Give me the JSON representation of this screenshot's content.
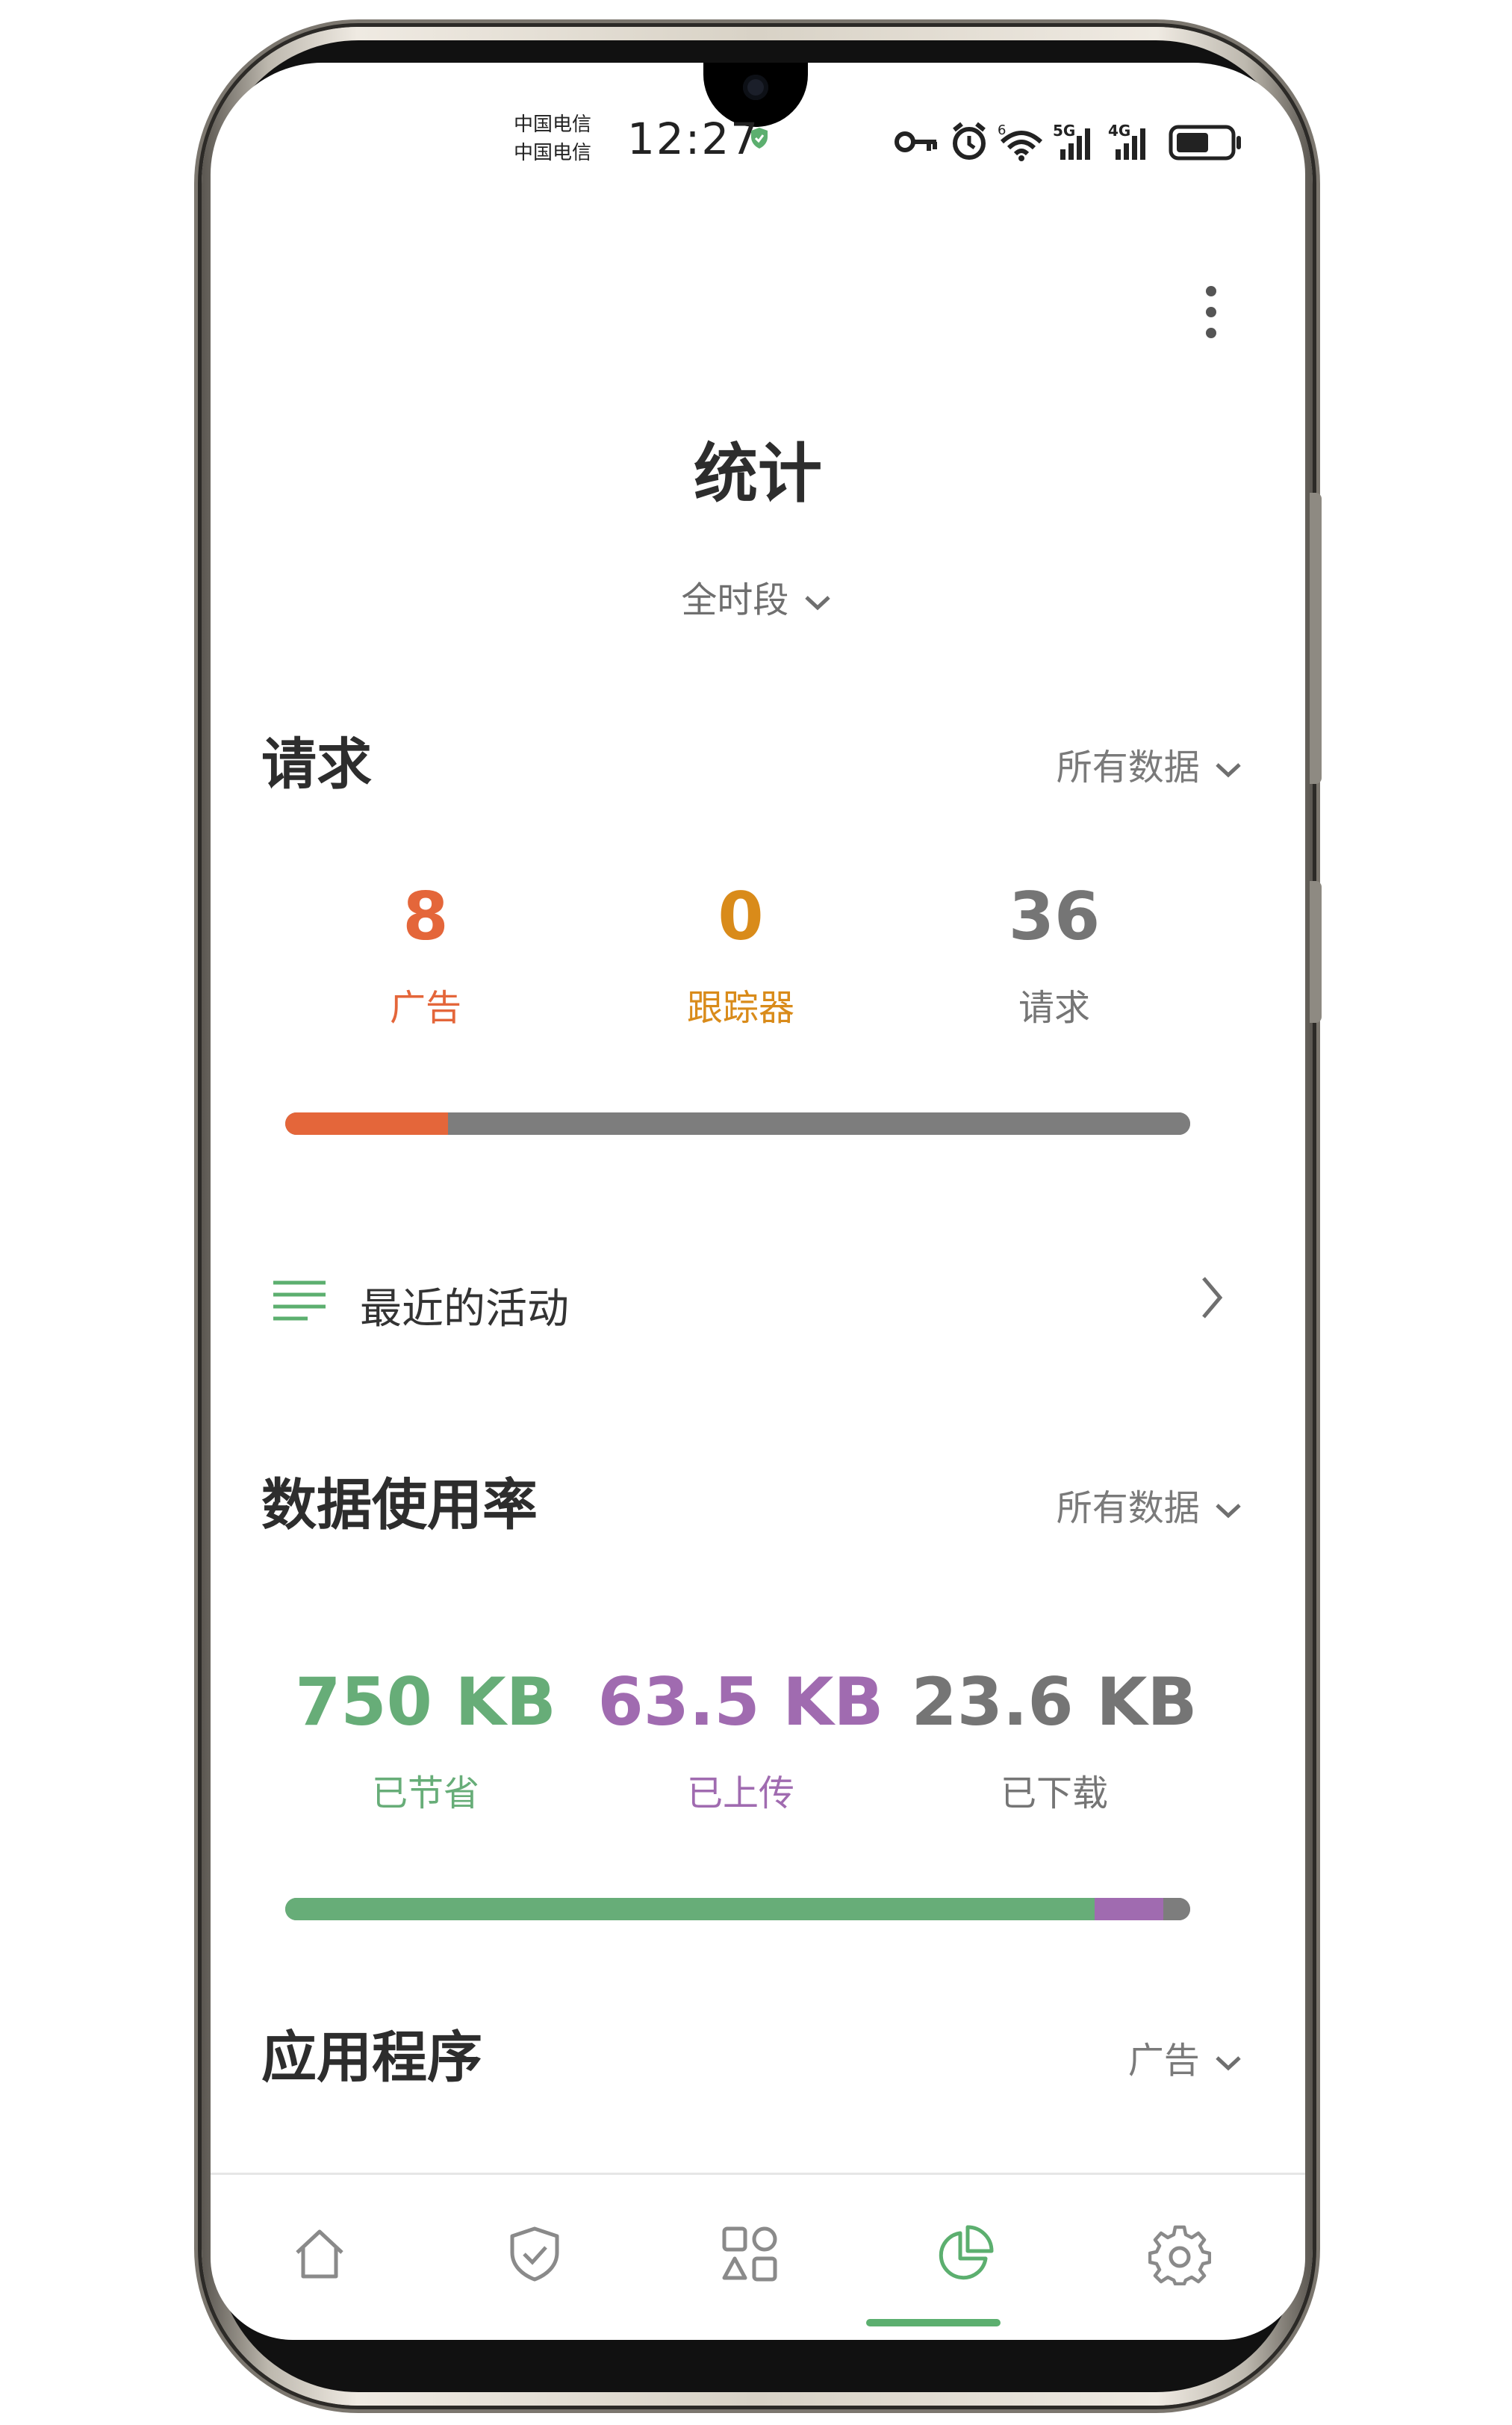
{
  "status_bar": {
    "carrier_1": "中国电信",
    "carrier_2": "中国电信",
    "time": "12:27"
  },
  "header": {
    "title": "统计",
    "period": "全时段"
  },
  "requests": {
    "title": "请求",
    "filter": "所有数据",
    "stats": [
      {
        "value": "8",
        "label": "广告",
        "color": "#e4663a"
      },
      {
        "value": "0",
        "label": "跟踪器",
        "color": "#d98b1a"
      },
      {
        "value": "36",
        "label": "请求",
        "color": "#757575"
      }
    ],
    "bar": [
      {
        "name": "ads",
        "fraction": 0.18,
        "color": "#e4663a"
      },
      {
        "name": "other",
        "fraction": 0.82,
        "color": "#7d7d7d"
      }
    ]
  },
  "recent": {
    "label": "最近的活动"
  },
  "data_usage": {
    "title": "数据使用率",
    "filter": "所有数据",
    "stats": [
      {
        "value": "750 KB",
        "label": "已节省",
        "color": "#67ad78"
      },
      {
        "value": "63.5 KB",
        "label": "已上传",
        "color": "#a06bb0"
      },
      {
        "value": "23.6 KB",
        "label": "已下载",
        "color": "#757575"
      }
    ],
    "bar": [
      {
        "name": "saved",
        "fraction": 0.894,
        "color": "#67ad78"
      },
      {
        "name": "uploaded",
        "fraction": 0.076,
        "color": "#a06bb0"
      },
      {
        "name": "downloaded",
        "fraction": 0.03,
        "color": "#7d7d7d"
      }
    ]
  },
  "apps": {
    "title": "应用程序",
    "filter": "广告"
  },
  "tabs": [
    {
      "name": "home",
      "icon": "home-icon",
      "active": false
    },
    {
      "name": "protection",
      "icon": "shield-icon",
      "active": false
    },
    {
      "name": "apps",
      "icon": "apps-grid-icon",
      "active": false
    },
    {
      "name": "statistics",
      "icon": "pie-chart-icon",
      "active": true
    },
    {
      "name": "settings",
      "icon": "gear-icon",
      "active": false
    }
  ],
  "colors": {
    "accent": "#5caf6f",
    "tab_inactive": "#8a8a8a"
  }
}
